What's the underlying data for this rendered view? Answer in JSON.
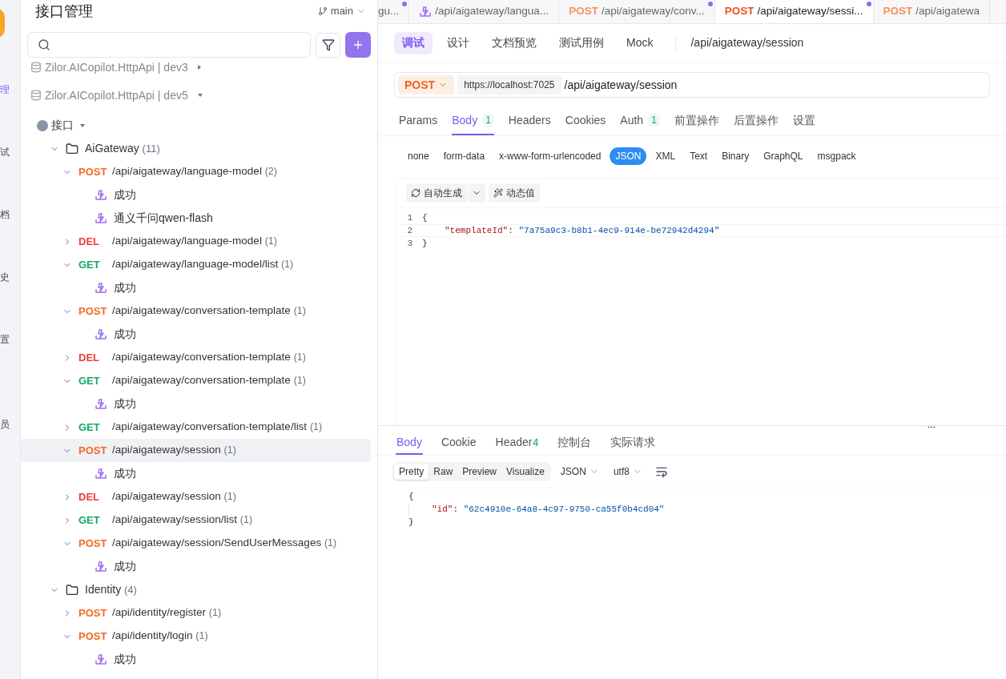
{
  "rail": {
    "items": [
      {
        "label": "理",
        "selected": true
      },
      {
        "label": "试",
        "selected": false
      },
      {
        "label": "档",
        "selected": false
      },
      {
        "label": "史",
        "selected": false
      },
      {
        "label": "置",
        "selected": false
      },
      {
        "label": "员",
        "selected": false
      }
    ]
  },
  "sidebar": {
    "title": "接口管理",
    "branch": "main",
    "projects": [
      {
        "name": "Zilor.AICopilot.HttpApi | dev3",
        "expanded": false
      },
      {
        "name": "Zilor.AICopilot.HttpApi | dev5",
        "expanded": true
      }
    ],
    "tree": [
      {
        "kind": "root",
        "name": "接口",
        "expanded": true,
        "children": [
          {
            "kind": "folder",
            "name": "AiGateway",
            "count": "(11)",
            "expanded": true,
            "children": [
              {
                "kind": "endpoint",
                "method": "POST",
                "path": "/api/aigateway/language-model",
                "count": "(2)",
                "expanded": true,
                "selected": false,
                "children": [
                  {
                    "kind": "example",
                    "name": "成功"
                  },
                  {
                    "kind": "example",
                    "name": "通义千问qwen-flash"
                  }
                ]
              },
              {
                "kind": "endpoint",
                "method": "DEL",
                "path": "/api/aigateway/language-model",
                "count": "(1)",
                "expanded": false,
                "selected": false
              },
              {
                "kind": "endpoint",
                "method": "GET",
                "path": "/api/aigateway/language-model/list",
                "count": "(1)",
                "expanded": true,
                "selected": false,
                "children": [
                  {
                    "kind": "example",
                    "name": "成功"
                  }
                ]
              },
              {
                "kind": "endpoint",
                "method": "POST",
                "path": "/api/aigateway/conversation-template",
                "count": "(1)",
                "expanded": true,
                "selected": false,
                "children": [
                  {
                    "kind": "example",
                    "name": "成功"
                  }
                ]
              },
              {
                "kind": "endpoint",
                "method": "DEL",
                "path": "/api/aigateway/conversation-template",
                "count": "(1)",
                "expanded": false,
                "selected": false
              },
              {
                "kind": "endpoint",
                "method": "GET",
                "path": "/api/aigateway/conversation-template",
                "count": "(1)",
                "expanded": true,
                "selected": false,
                "children": [
                  {
                    "kind": "example",
                    "name": "成功"
                  }
                ]
              },
              {
                "kind": "endpoint",
                "method": "GET",
                "path": "/api/aigateway/conversation-template/list",
                "count": "(1)",
                "expanded": false,
                "selected": false
              },
              {
                "kind": "endpoint",
                "method": "POST",
                "path": "/api/aigateway/session",
                "count": "(1)",
                "expanded": true,
                "selected": true,
                "children": [
                  {
                    "kind": "example",
                    "name": "成功"
                  }
                ]
              },
              {
                "kind": "endpoint",
                "method": "DEL",
                "path": "/api/aigateway/session",
                "count": "(1)",
                "expanded": false,
                "selected": false
              },
              {
                "kind": "endpoint",
                "method": "GET",
                "path": "/api/aigateway/session/list",
                "count": "(1)",
                "expanded": false,
                "selected": false
              },
              {
                "kind": "endpoint",
                "method": "POST",
                "path": "/api/aigateway/session/SendUserMessages",
                "count": "(1)",
                "expanded": true,
                "selected": false,
                "children": [
                  {
                    "kind": "example",
                    "name": "成功"
                  }
                ]
              }
            ]
          },
          {
            "kind": "folder",
            "name": "Identity",
            "count": "(4)",
            "expanded": true,
            "children": [
              {
                "kind": "endpoint",
                "method": "POST",
                "path": "/api/identity/register",
                "count": "(1)",
                "expanded": false,
                "selected": false
              },
              {
                "kind": "endpoint",
                "method": "POST",
                "path": "/api/identity/login",
                "count": "(1)",
                "expanded": true,
                "selected": false,
                "children": [
                  {
                    "kind": "example",
                    "name": "成功"
                  }
                ]
              }
            ]
          }
        ]
      }
    ]
  },
  "open_tabs": [
    {
      "kind": "plain",
      "label": "gu...",
      "selected": false,
      "modified": true
    },
    {
      "kind": "example",
      "label": "/api/aigateway/langua...",
      "selected": false,
      "modified": false
    },
    {
      "kind": "request",
      "method": "POST",
      "label": "/api/aigateway/conv...",
      "selected": false,
      "modified": true
    },
    {
      "kind": "request",
      "method": "POST",
      "label": "/api/aigateway/sessi...",
      "selected": true,
      "modified": true
    },
    {
      "kind": "request",
      "method": "POST",
      "label": "/api/aigatewa",
      "selected": false,
      "modified": false
    }
  ],
  "mode_tabs": [
    {
      "label": "调试",
      "selected": true
    },
    {
      "label": "设计",
      "selected": false
    },
    {
      "label": "文档预览",
      "selected": false
    },
    {
      "label": "测试用例",
      "selected": false
    },
    {
      "label": "Mock",
      "selected": false
    }
  ],
  "endpoint_path": "/api/aigateway/session",
  "request": {
    "method": "POST",
    "base_url": "https://localhost:7025",
    "path": "/api/aigateway/session"
  },
  "request_tabs": [
    {
      "label": "Params",
      "selected": false
    },
    {
      "label": "Body",
      "badge": "1",
      "selected": true
    },
    {
      "label": "Headers",
      "selected": false
    },
    {
      "label": "Cookies",
      "selected": false
    },
    {
      "label": "Auth",
      "badge": "1",
      "selected": false
    },
    {
      "label": "前置操作",
      "selected": false
    },
    {
      "label": "后置操作",
      "selected": false
    },
    {
      "label": "设置",
      "selected": false
    }
  ],
  "body_types": [
    {
      "label": "none",
      "selected": false
    },
    {
      "label": "form-data",
      "selected": false
    },
    {
      "label": "x-www-form-urlencoded",
      "selected": false
    },
    {
      "label": "JSON",
      "selected": true
    },
    {
      "label": "XML",
      "selected": false
    },
    {
      "label": "Text",
      "selected": false
    },
    {
      "label": "Binary",
      "selected": false
    },
    {
      "label": "GraphQL",
      "selected": false
    },
    {
      "label": "msgpack",
      "selected": false
    }
  ],
  "body_toolbar": {
    "generate": "自动生成",
    "dynamic": "动态值"
  },
  "body_editor": [
    {
      "number": "1",
      "kind": "brace",
      "text": "{"
    },
    {
      "number": "2",
      "kind": "pair",
      "key": "\"templateId\"",
      "separator": ":",
      "value": "\"7a75a9c3-b8b1-4ec9-914e-be72942d4294\""
    },
    {
      "number": "3",
      "kind": "brace",
      "text": "}"
    }
  ],
  "response_tabs": [
    {
      "label": "Body",
      "selected": true
    },
    {
      "label": "Cookie",
      "selected": false
    },
    {
      "label": "Header",
      "badge": "4",
      "selected": false
    },
    {
      "label": "控制台",
      "selected": false
    },
    {
      "label": "实际请求",
      "selected": false
    }
  ],
  "view_modes": [
    {
      "label": "Pretty",
      "selected": true
    },
    {
      "label": "Raw",
      "selected": false
    },
    {
      "label": "Preview",
      "selected": false
    },
    {
      "label": "Visualize",
      "selected": false
    }
  ],
  "format": "JSON",
  "encoding": "utf8",
  "response_body": [
    {
      "kind": "brace",
      "text": "{"
    },
    {
      "kind": "pair",
      "key": "\"id\"",
      "separator": ":",
      "value": "\"62c4910e-64a8-4c97-9750-ca55f0b4cd04\""
    },
    {
      "kind": "brace",
      "text": "}"
    }
  ]
}
